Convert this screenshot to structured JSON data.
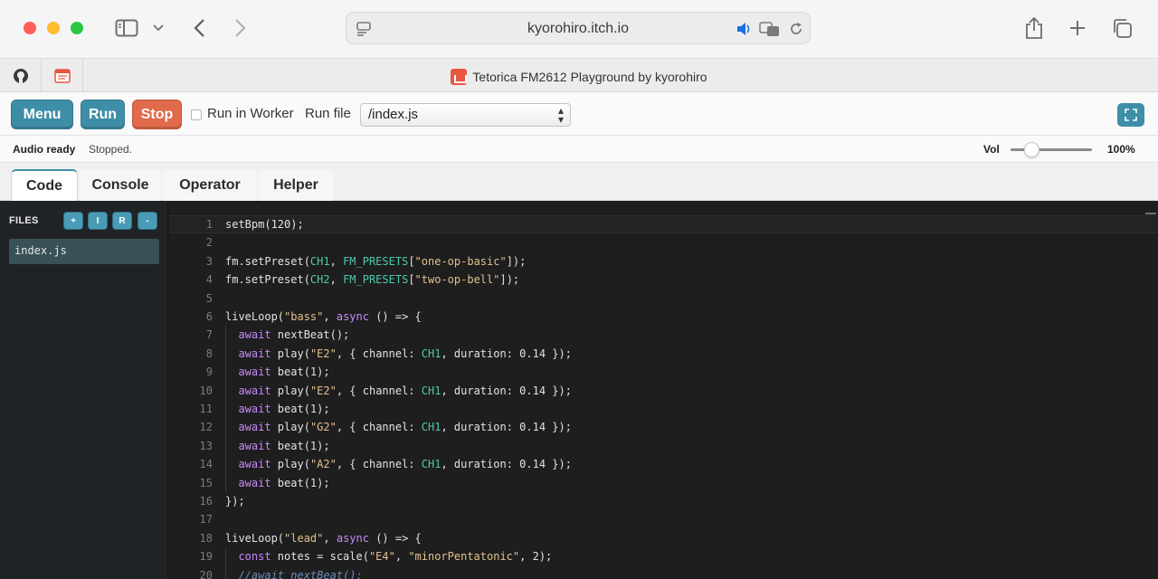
{
  "browser": {
    "url": "kyorohiro.itch.io",
    "tab_title": "Tetorica FM2612 Playground by kyorohiro"
  },
  "toolbar": {
    "menu_label": "Menu",
    "run_label": "Run",
    "stop_label": "Stop",
    "run_in_worker_label": "Run in Worker",
    "run_file_label": "Run file",
    "run_file_value": "/index.js",
    "colors": {
      "primary": "#3f8ea8",
      "stop": "#e06a49"
    }
  },
  "status": {
    "audio": "Audio ready",
    "state": "Stopped.",
    "vol_label": "Vol",
    "vol_percent": "100%",
    "vol_level": 0.2
  },
  "panel_tabs": [
    "Code",
    "Console",
    "Operator",
    "Helper"
  ],
  "sidebar": {
    "files_label": "FILES",
    "buttons": [
      "+",
      "I",
      "R",
      "-"
    ],
    "files": [
      "index.js"
    ]
  },
  "editor": {
    "lines": [
      "setBpm(120);",
      "",
      "fm.setPreset(CH1, FM_PRESETS[\"one-op-basic\"]);",
      "fm.setPreset(CH2, FM_PRESETS[\"two-op-bell\"]);",
      "",
      "liveLoop(\"bass\", async () => {",
      "  await nextBeat();",
      "  await play(\"E2\", { channel: CH1, duration: 0.14 });",
      "  await beat(1);",
      "  await play(\"E2\", { channel: CH1, duration: 0.14 });",
      "  await beat(1);",
      "  await play(\"G2\", { channel: CH1, duration: 0.14 });",
      "  await beat(1);",
      "  await play(\"A2\", { channel: CH1, duration: 0.14 });",
      "  await beat(1);",
      "});",
      "",
      "liveLoop(\"lead\", async () => {",
      "  const notes = scale(\"E4\", \"minorPentatonic\", 2);",
      "  //await nextBeat();"
    ]
  }
}
